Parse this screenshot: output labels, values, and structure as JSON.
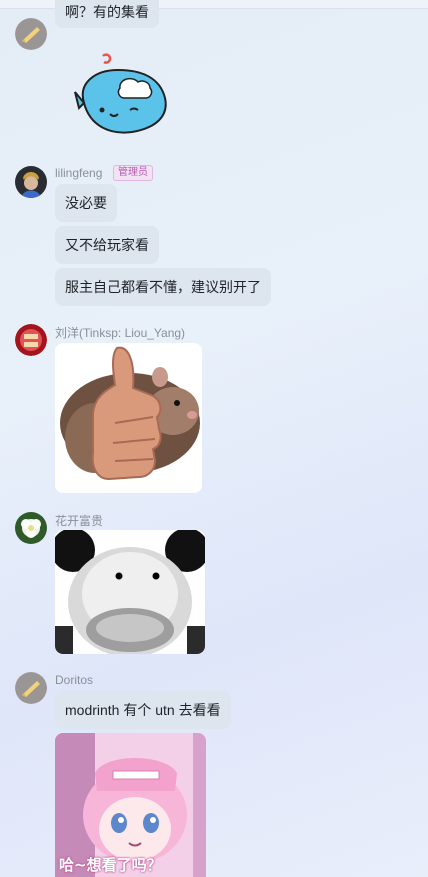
{
  "messages": {
    "m1": {
      "partial_text": "啊？有的集看"
    },
    "m2": {
      "sender": "lilingfeng",
      "badge": "管理员",
      "texts": [
        "没必要",
        "又不给玩家看",
        "服主自己都看不懂，建议别开了"
      ]
    },
    "m3": {
      "sender": "刘洋(Tinksp: Liou_Yang)",
      "image": "rat-thumbs-up-sticker"
    },
    "m4": {
      "sender": "花开富贵",
      "image": "blurry-panda-face-sticker"
    },
    "m5": {
      "sender": "Doritos",
      "text": "modrinth 有个 utn 去看看",
      "image_caption": "哈~想看了吗？"
    }
  },
  "colors": {
    "bubble": "#dde5ee",
    "badge_text": "#b45db0",
    "name": "#8a9099"
  },
  "icons": [
    "doritos-avatar-icon",
    "whale-sticker-icon"
  ]
}
